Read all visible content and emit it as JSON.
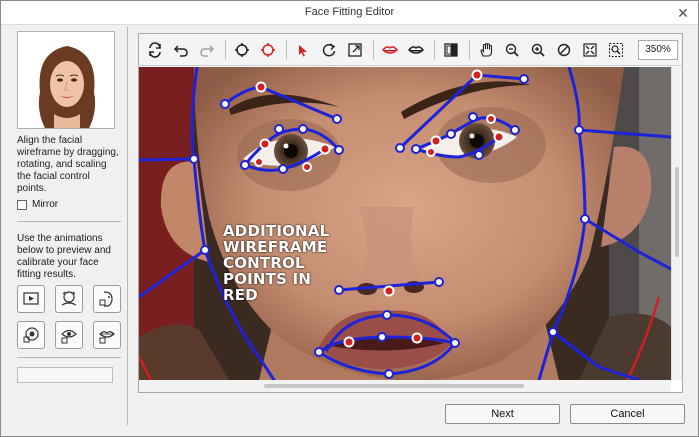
{
  "window": {
    "title": "Face Fitting Editor"
  },
  "sidebar": {
    "instructions": "Align the facial wireframe by dragging, rotating, and scaling the facial control points.",
    "mirror_label": "Mirror",
    "animations_text": "Use the animations below to preview and calibrate your face fitting results.",
    "animation_buttons": [
      {
        "name": "anim-play-icon"
      },
      {
        "name": "anim-head-rotate-icon"
      },
      {
        "name": "anim-face-turn-icon"
      },
      {
        "name": "anim-eye-look-icon"
      },
      {
        "name": "anim-eye-blink-icon"
      },
      {
        "name": "anim-lips-icon"
      }
    ],
    "progress": 0
  },
  "toolbar": {
    "zoom_value": "350%"
  },
  "viewport": {
    "annotation": "ADDITIONAL\nWIREFRAME\nCONTROL\nPOINTS IN\nRED"
  },
  "footer": {
    "next_label": "Next",
    "cancel_label": "Cancel"
  }
}
